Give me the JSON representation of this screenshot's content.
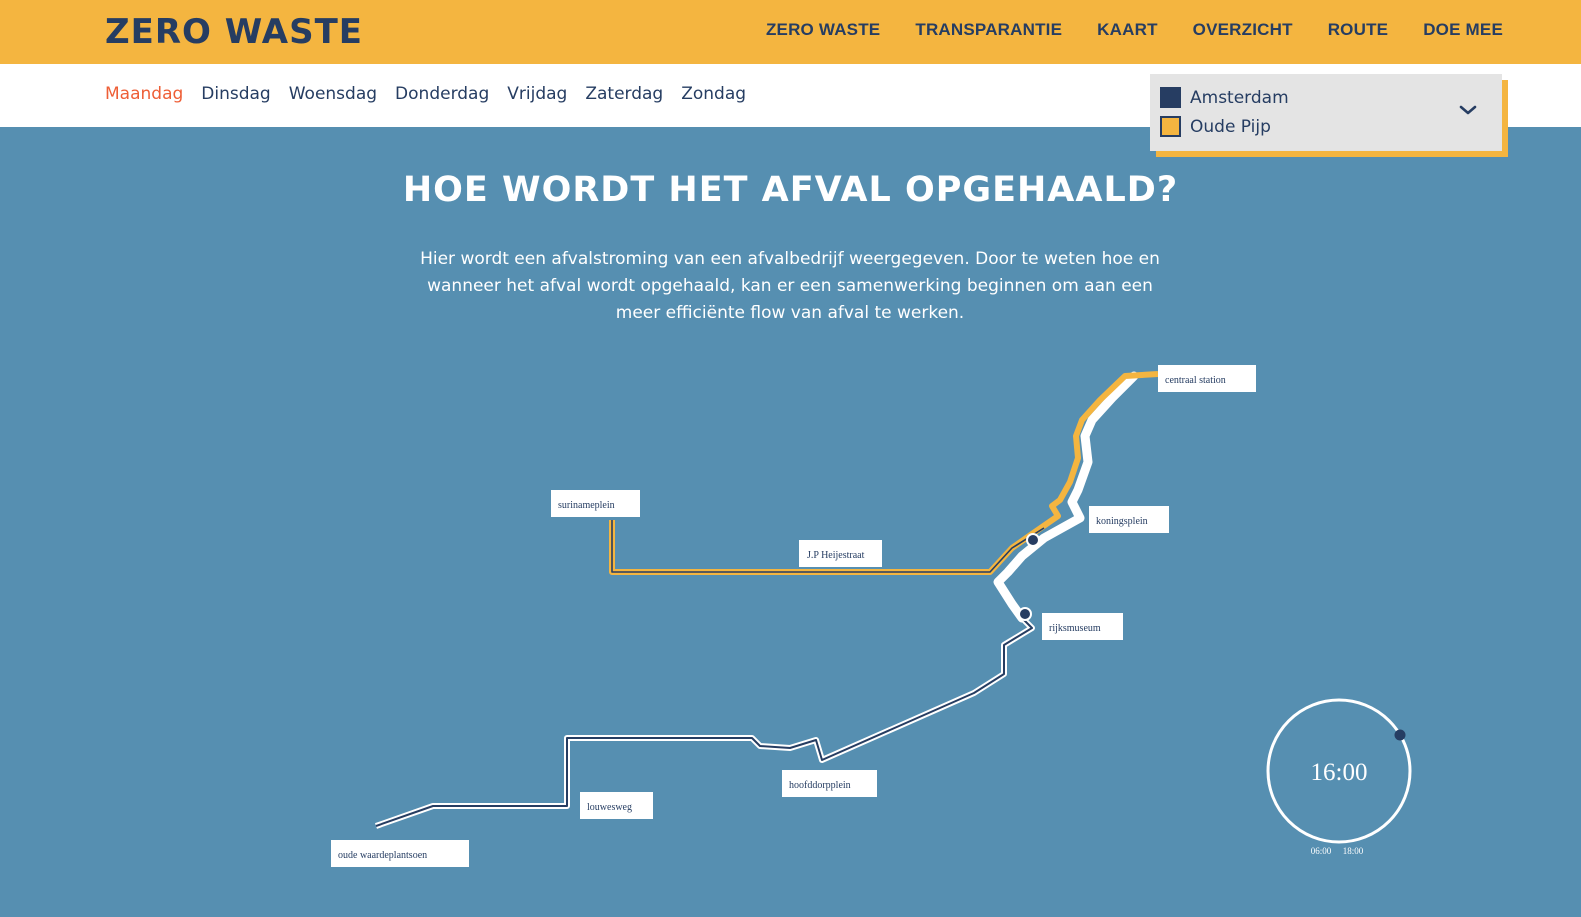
{
  "brand": {
    "logo": "ZERO WASTE"
  },
  "nav": [
    "ZERO WASTE",
    "TRANSPARANTIE",
    "KAART",
    "OVERZICHT",
    "ROUTE",
    "DOE MEE"
  ],
  "days": {
    "items": [
      "Maandag",
      "Dinsdag",
      "Woensdag",
      "Donderdag",
      "Vrijdag",
      "Zaterdag",
      "Zondag"
    ],
    "active": "Maandag"
  },
  "legend": {
    "items": [
      {
        "label": "Amsterdam",
        "color": "#263d62"
      },
      {
        "label": "Oude Pijp",
        "color": "#f4b540"
      }
    ]
  },
  "section": {
    "title": "HOE WORDT HET AFVAL OPGEHAALD?",
    "intro_lines": [
      "Hier wordt een afvalstroming van een afvalbedrijf weergegeven. Door te weten hoe en",
      "wanneer het afval wordt opgehaald, kan er een samenwerking beginnen om aan een",
      "meer efficiënte flow van afval te werken."
    ]
  },
  "map": {
    "places": {
      "centraal": "centraal station",
      "suriname": "surinameplein",
      "heijestraat": "J.P Heijestraat",
      "koning": "koningsplein",
      "rijks": "rijksmuseum",
      "hoofddorp": "hoofddorpplein",
      "louwes": "louwesweg",
      "oude": "oude waardeplantsoen"
    }
  },
  "clock": {
    "time": "16:00",
    "start": "06:00",
    "end": "18:00"
  },
  "colors": {
    "brand_yellow": "#f4b540",
    "navy": "#263d62",
    "accent": "#ee5e36",
    "background": "#568fb1"
  }
}
